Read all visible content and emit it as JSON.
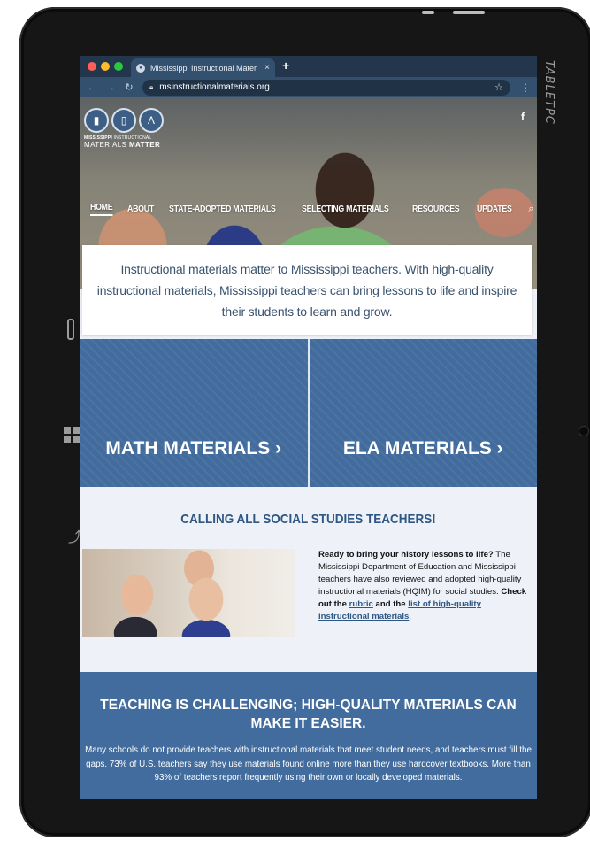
{
  "device": {
    "brand": "TABLETPC"
  },
  "browser": {
    "tab_title": "Mississippi Instructional Mater",
    "tab_close": "×",
    "new_tab": "+",
    "url": "msinstructionalmaterials.org",
    "icons": [
      "back-icon",
      "forward-icon",
      "reload-icon",
      "lock-icon",
      "star-icon",
      "menu-icon"
    ]
  },
  "site": {
    "logo_line1_bold": "MISSISSIPPI",
    "logo_line1_rest": " INSTRUCTIONAL",
    "logo_line2_rest": "MATERIALS ",
    "logo_line2_bold": "MATTER",
    "facebook": "f",
    "nav": [
      {
        "label": "HOME",
        "active": true
      },
      {
        "label": "ABOUT"
      },
      {
        "label": "STATE-ADOPTED MATERIALS"
      },
      {
        "label": "SELECTING MATERIALS"
      },
      {
        "label": "RESOURCES"
      },
      {
        "label": "UPDATES"
      }
    ],
    "intro": "Instructional materials matter to Mississippi teachers. With high-quality instructional materials, Mississippi teachers can bring lessons to life and inspire their students to learn and grow.",
    "math_label": "MATH MATERIALS ›",
    "ela_label": "ELA MATERIALS ›",
    "social": {
      "title": "CALLING ALL SOCIAL STUDIES TEACHERS!",
      "lead": "Ready to bring your history lessons to life?",
      "body": " The Mississippi Department of Education and Mississippi teachers have also reviewed and adopted high-quality instructional materials (HQIM) for social studies. ",
      "check": "Check out the ",
      "rubric_link": "rubric",
      "and_the": " and the ",
      "list_link": "list of high-quality instructional materials",
      "period": "."
    },
    "teaching": {
      "title": "TEACHING IS CHALLENGING; HIGH-QUALITY MATERIALS CAN MAKE IT EASIER.",
      "body": "Many schools do not provide teachers with instructional materials that meet student needs, and teachers must fill the gaps. 73% of U.S. teachers say they use materials found online more than they use hardcover textbooks. More than 93% of teachers report frequently using their own or locally developed materials."
    }
  }
}
